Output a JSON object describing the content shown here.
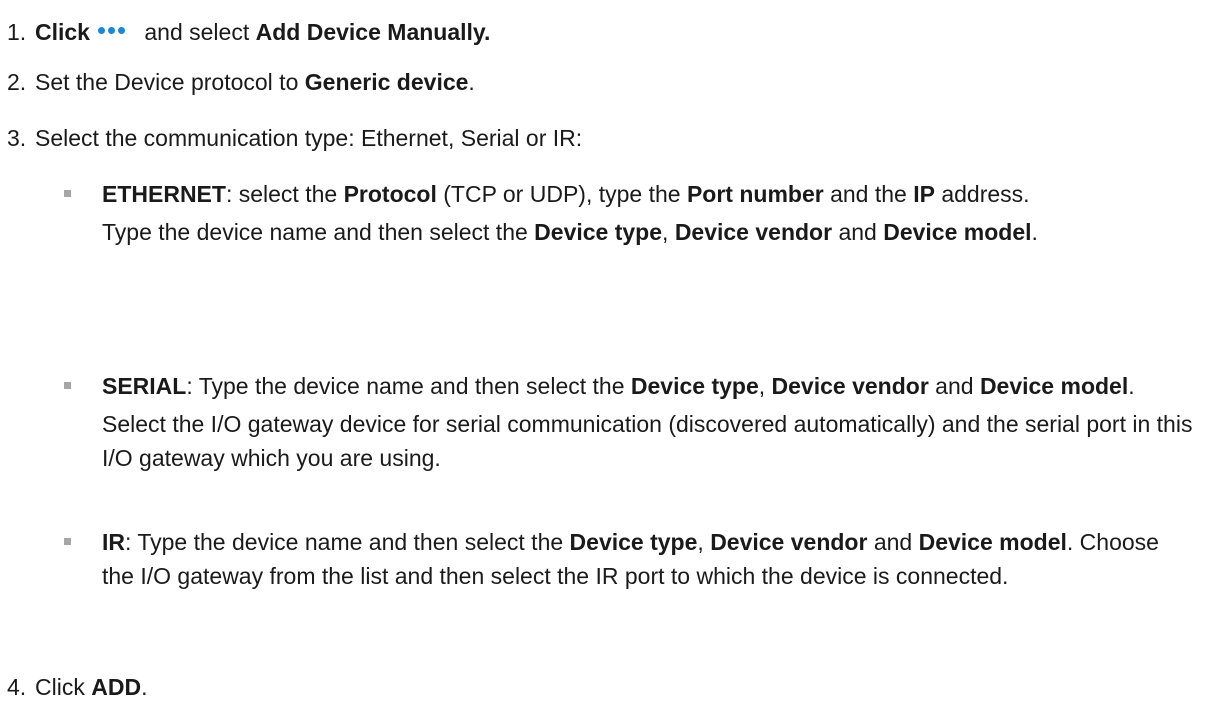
{
  "steps": {
    "s1": {
      "num": "1.",
      "lead": "Click",
      "icon": "more-dots-icon",
      "mid": " and select ",
      "bold": "Add Device Manually."
    },
    "s2": {
      "num": "2.",
      "pre": "Set the Device protocol to ",
      "bold": "Generic device",
      "post": "."
    },
    "s3": {
      "num": "3.",
      "text": "Select the communication type: Ethernet, Serial or IR:"
    },
    "s4": {
      "num": "4.",
      "pre": "Click ",
      "bold": "ADD",
      "post": "."
    }
  },
  "bullets": {
    "ethernet": {
      "t1": "ETHERNET",
      "t2": ": select the ",
      "t3": "Protocol",
      "t4": " (TCP or UDP), type the ",
      "t5": "Port number",
      "t6": " and the ",
      "t7": "IP",
      "t8": " address.",
      "c1": "Type the device name and then select the ",
      "c2": "Device type",
      "c3": ", ",
      "c4": "Device vendor",
      "c5": " and ",
      "c6": "Device model",
      "c7": "."
    },
    "serial": {
      "t1": "SERIAL",
      "t2": ": Type the device name and then select the ",
      "t3": "Device type",
      "t4": ", ",
      "t5": "Device vendor",
      "t6": " and ",
      "t7": "Device model",
      "t8": ".",
      "c1": "Select the I/O gateway device for serial communication (discovered automatically) and the serial port in this I/O gateway which you are using."
    },
    "ir": {
      "t1": "IR",
      "t2": ": Type the device name and then select the ",
      "t3": "Device type",
      "t4": ", ",
      "t5": "Device vendor",
      "t6": " and ",
      "t7": "Device model",
      "t8": ". Choose the I/O gateway from the list and then select the IR port to which the device is connected."
    }
  },
  "colors": {
    "icon_dots": "#1a86d9",
    "bullet_square": "#a6a6a6",
    "text": "#1a1a1a"
  }
}
